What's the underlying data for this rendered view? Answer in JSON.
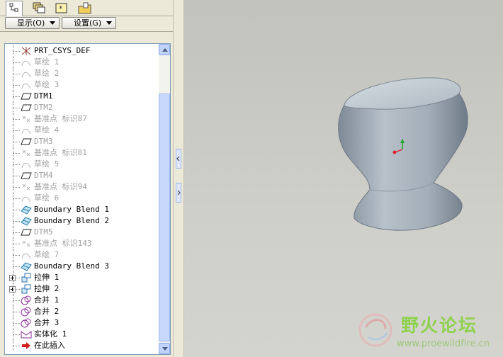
{
  "tabs": [
    {
      "icon": "model-tree-icon",
      "active": true
    },
    {
      "icon": "layers-icon",
      "active": false
    },
    {
      "icon": "favorites-icon",
      "active": false
    },
    {
      "icon": "folder-browser-icon",
      "active": false
    }
  ],
  "toolbar": {
    "show_label": "显示(O)",
    "settings_label": "设置(G)"
  },
  "tree_items": [
    {
      "label": "PRT_CSYS_DEF",
      "icon": "coordinate-system-icon",
      "dim": false
    },
    {
      "label": "草绘 1",
      "icon": "sketch-icon",
      "dim": true
    },
    {
      "label": "草绘 2",
      "icon": "sketch-icon",
      "dim": true
    },
    {
      "label": "草绘 3",
      "icon": "sketch-icon",
      "dim": true
    },
    {
      "label": "DTM1",
      "icon": "datum-plane-icon",
      "dim": false
    },
    {
      "label": "DTM2",
      "icon": "datum-plane-icon",
      "dim": true
    },
    {
      "label": "基准点 标识87",
      "icon": "datum-point-icon",
      "dim": true
    },
    {
      "label": "草绘 4",
      "icon": "sketch-icon",
      "dim": true
    },
    {
      "label": "DTM3",
      "icon": "datum-plane-icon",
      "dim": true
    },
    {
      "label": "基准点 标识81",
      "icon": "datum-point-icon",
      "dim": true
    },
    {
      "label": "草绘 5",
      "icon": "sketch-icon",
      "dim": true
    },
    {
      "label": "DTM4",
      "icon": "datum-plane-icon",
      "dim": true
    },
    {
      "label": "基准点 标识94",
      "icon": "datum-point-icon",
      "dim": true
    },
    {
      "label": "草绘 6",
      "icon": "sketch-icon",
      "dim": true
    },
    {
      "label": "Boundary Blend 1",
      "icon": "boundary-blend-icon",
      "dim": false
    },
    {
      "label": "Boundary Blend 2",
      "icon": "boundary-blend-icon",
      "dim": false
    },
    {
      "label": "DTM5",
      "icon": "datum-plane-icon",
      "dim": true
    },
    {
      "label": "基准点 标识143",
      "icon": "datum-point-icon",
      "dim": true
    },
    {
      "label": "草绘 7",
      "icon": "sketch-icon",
      "dim": true
    },
    {
      "label": "Boundary Blend 3",
      "icon": "boundary-blend-icon",
      "dim": false
    },
    {
      "label": "拉伸 1",
      "icon": "extrude-icon",
      "dim": false,
      "expandable": true
    },
    {
      "label": "拉伸 2",
      "icon": "extrude-icon",
      "dim": false,
      "expandable": true
    },
    {
      "label": "合并 1",
      "icon": "merge-icon",
      "dim": false
    },
    {
      "label": "合并 2",
      "icon": "merge-icon",
      "dim": false
    },
    {
      "label": "合并 3",
      "icon": "merge-icon",
      "dim": false
    },
    {
      "label": "实体化 1",
      "icon": "solidify-icon",
      "dim": false
    },
    {
      "label": "在此插入",
      "icon": "insert-here-arrow-icon",
      "dim": false
    }
  ],
  "watermark": {
    "title": "野火论坛",
    "url": "www.proewildfire.cn"
  },
  "colors": {
    "model_surface": "#a9b3bd",
    "model_top": "#c5cdd4",
    "dim_text": "#a0a0a0",
    "watermark_green": "#8ed14d"
  }
}
